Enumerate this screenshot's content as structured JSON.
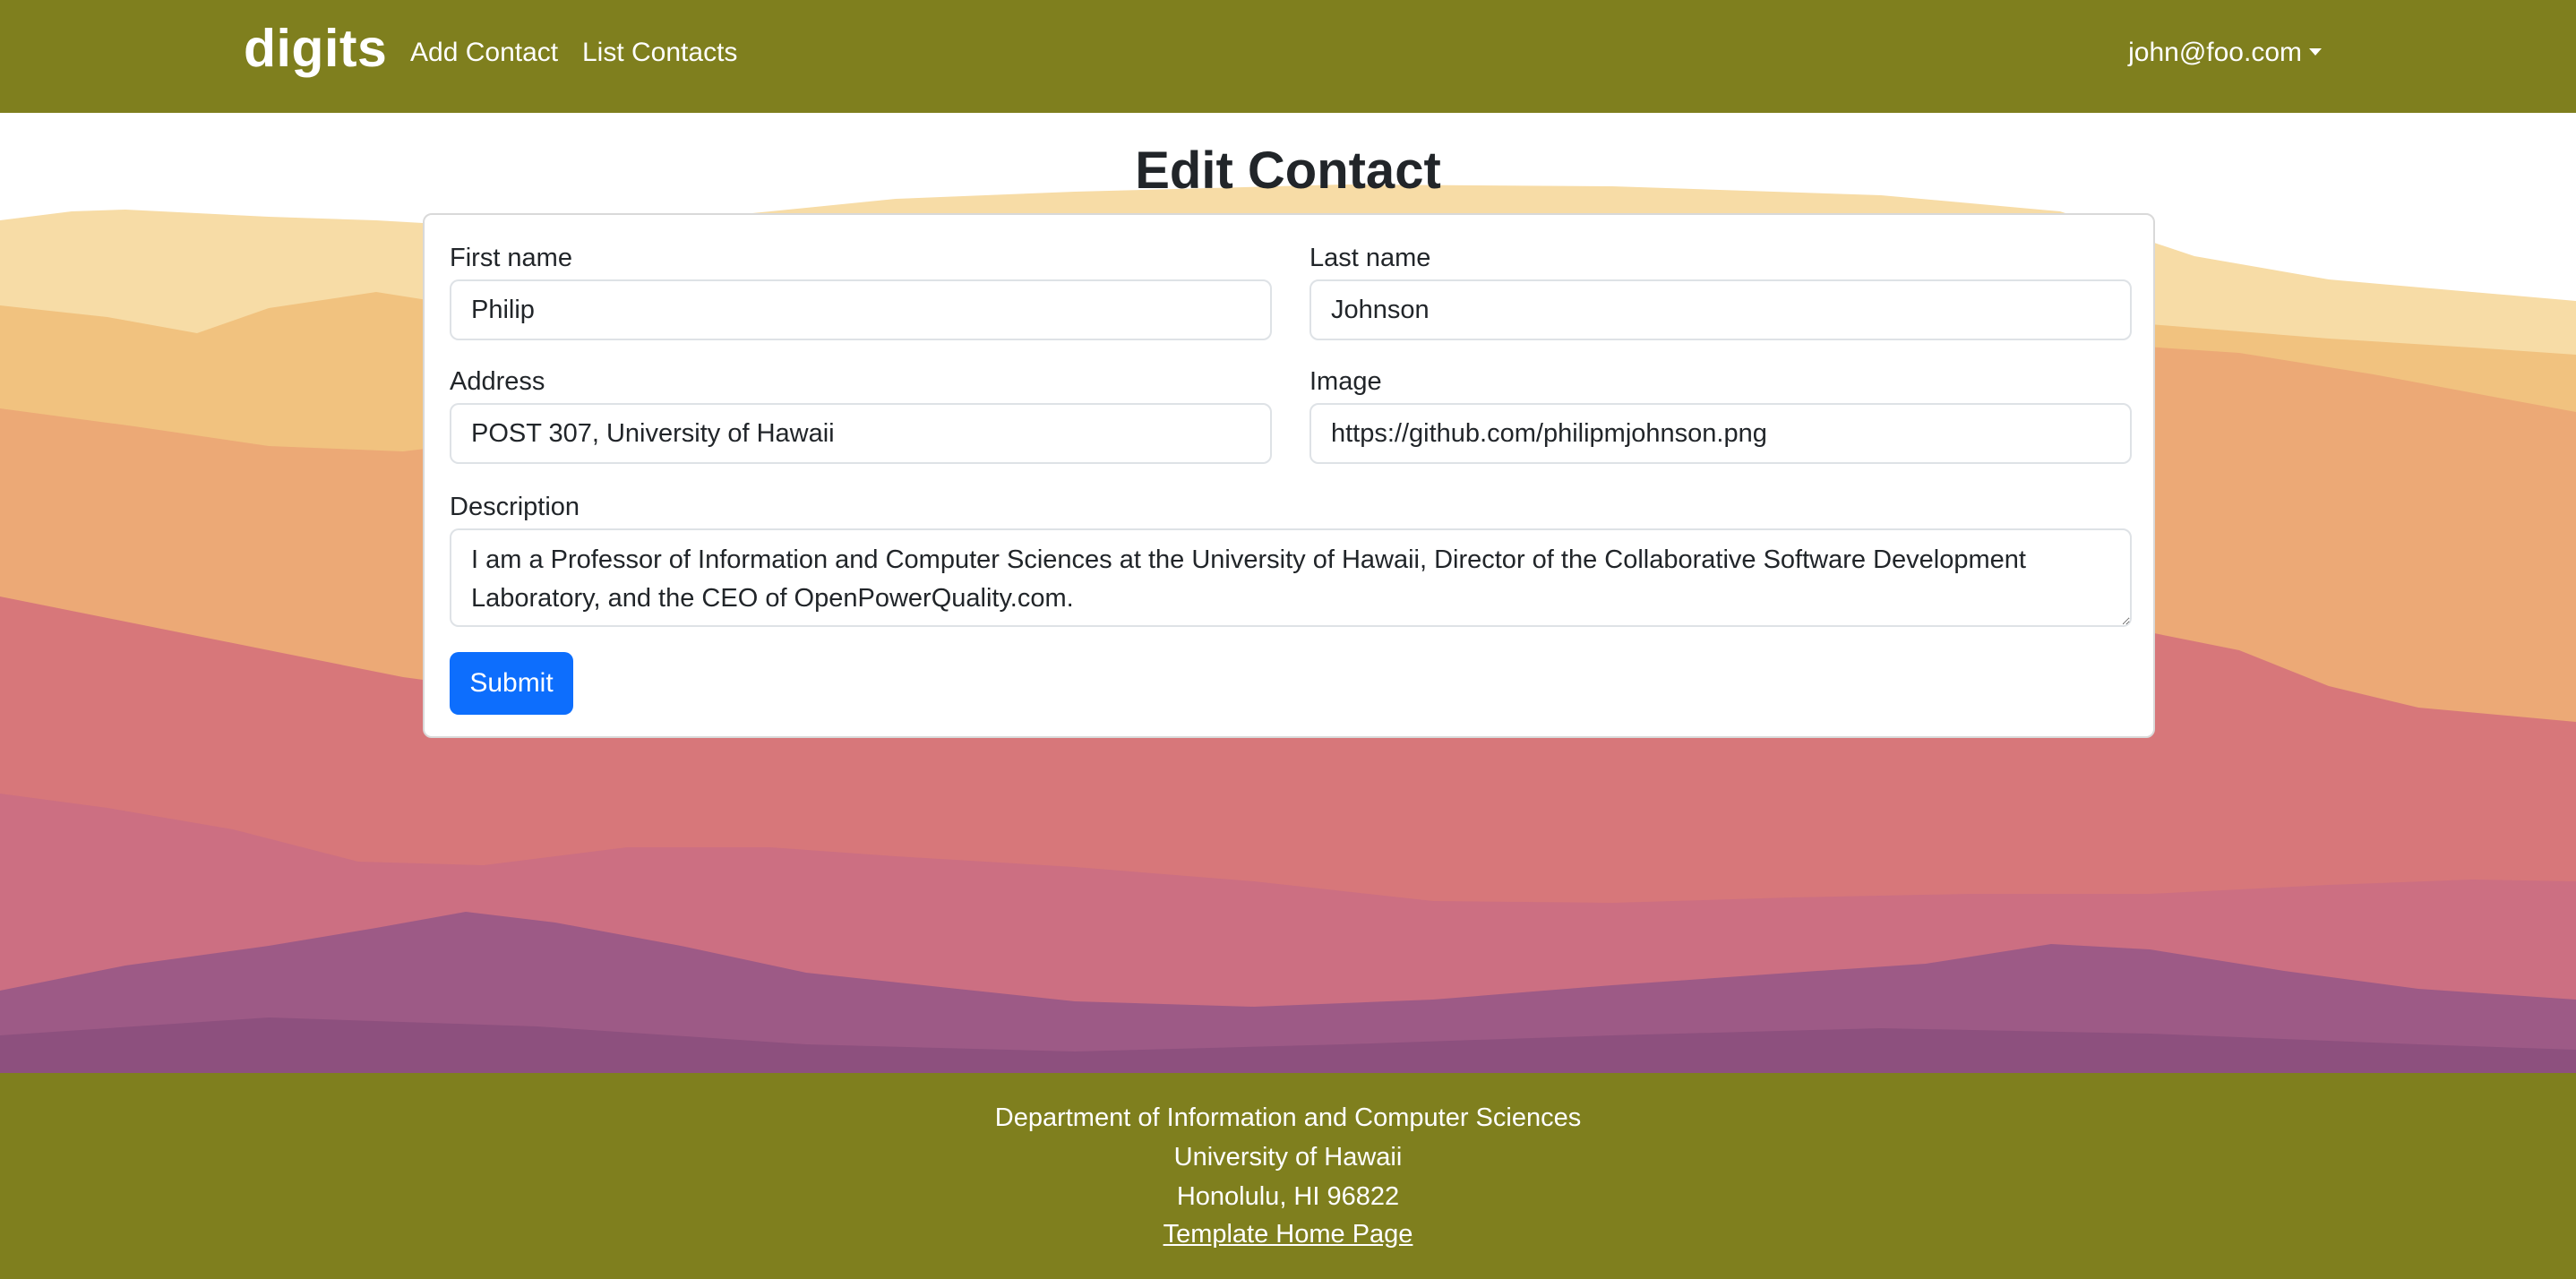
{
  "navbar": {
    "brand": "digits",
    "links": [
      {
        "label": "Add Contact"
      },
      {
        "label": "List Contacts"
      }
    ],
    "user": "john@foo.com"
  },
  "page": {
    "title": "Edit Contact"
  },
  "form": {
    "first_name": {
      "label": "First name",
      "value": "Philip"
    },
    "last_name": {
      "label": "Last name",
      "value": "Johnson"
    },
    "address": {
      "label": "Address",
      "value": "POST 307, University of Hawaii"
    },
    "image": {
      "label": "Image",
      "value": "https://github.com/philipmjohnson.png"
    },
    "description": {
      "label": "Description",
      "value": "I am a Professor of Information and Computer Sciences at the University of Hawaii, Director of the Collaborative Software Development Laboratory, and the CEO of OpenPowerQuality.com."
    },
    "submit_label": "Submit"
  },
  "footer": {
    "lines": [
      "Department of Information and Computer Sciences",
      "University of Hawaii",
      "Honolulu, HI 96822"
    ],
    "link_label": "Template Home Page"
  },
  "colors": {
    "navbar_bg": "#7f7f1e",
    "primary_button": "#0d6efd"
  }
}
